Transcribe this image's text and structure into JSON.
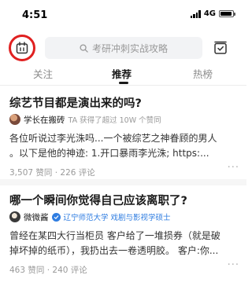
{
  "status_bar": {
    "time": "4:51",
    "network": "4G",
    "signal_bars": 4,
    "battery_level": 0.9
  },
  "top_bar": {
    "calendar_icon": "calendar-icon",
    "search_icon": "search-icon",
    "search_placeholder": "考研冲刺实战攻略",
    "edit_icon": "edit-icon"
  },
  "tabs": {
    "follow": "关注",
    "recommend": "推荐",
    "hot": "热榜",
    "active": "推荐"
  },
  "feed": [
    {
      "title": "综艺节目都是演出来的吗?",
      "author": "学长在搬砖",
      "author_meta": "TA 获得了超过 10W 个赞同",
      "excerpt_lines": [
        "各位听说过李光洙吗...一个被综艺之神眷顾的男人",
        "。以下是他的神迹:  1.开口暴雨李光洙;  https:..."
      ],
      "stats": "3,507 赞同 · 226 评论",
      "more_icon": "more-icon"
    },
    {
      "title": "哪一个瞬间你觉得自己应该离职了?",
      "author": "微微酱",
      "author_verify": "辽宁师范大学 戏剧与影视学硕士",
      "excerpt_lines": [
        "曾经在某四大行当柜员 客户给了一堆损券（就是破",
        "掉坏掉的纸币），我扔出去一卷透明胶。 客户:你..."
      ],
      "stats": "463 赞同 · 240 评论",
      "more_icon": "more-icon"
    }
  ],
  "colors": {
    "highlight_circle": "#e02020",
    "verified_blue": "#2f7de1",
    "search_bg": "#f2f3f5"
  }
}
